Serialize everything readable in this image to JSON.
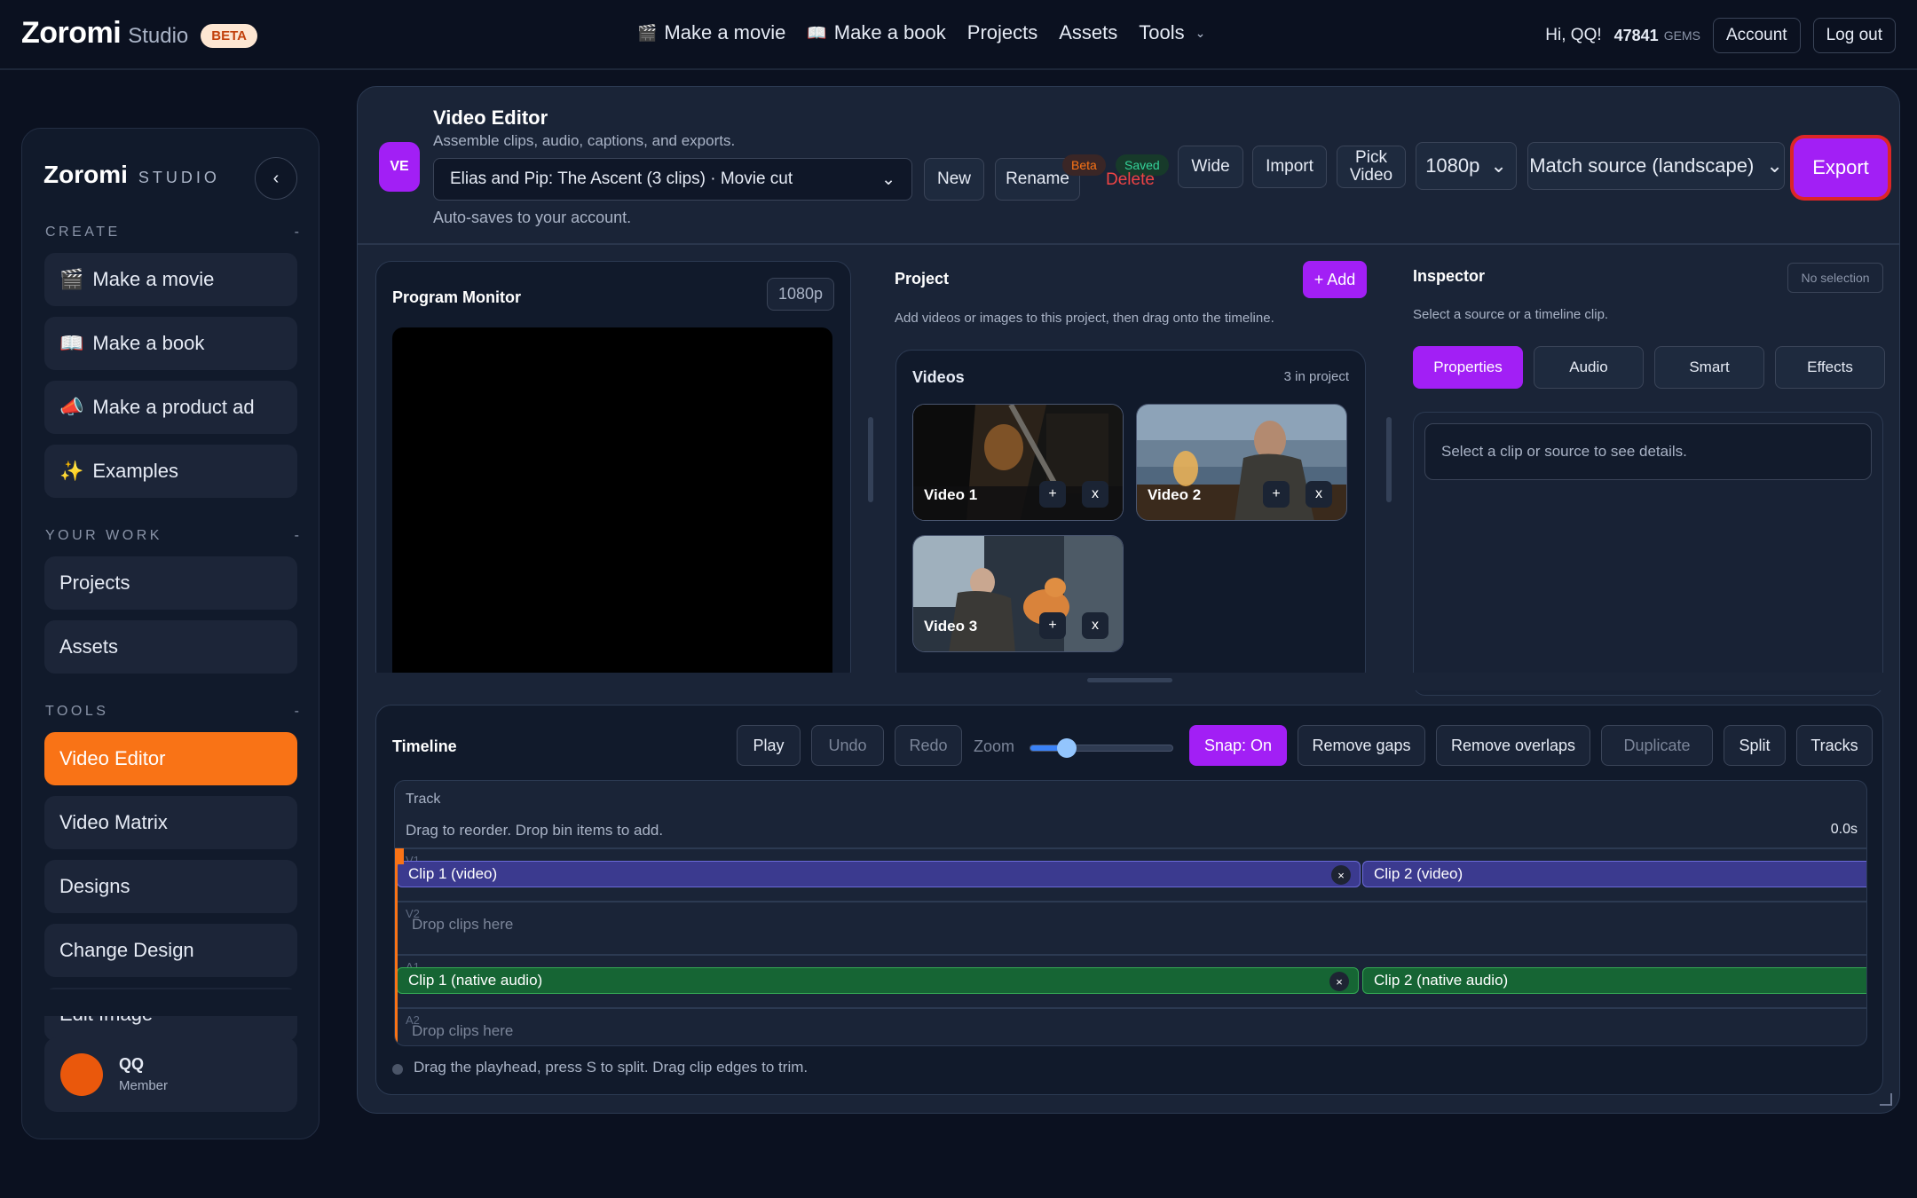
{
  "topnav": {
    "brand": "Zoromi",
    "brand_sub": "Studio",
    "beta": "BETA",
    "items": [
      {
        "icon": "🎬",
        "label": "Make a movie"
      },
      {
        "icon": "📖",
        "label": "Make a book"
      },
      {
        "icon": "",
        "label": "Projects"
      },
      {
        "icon": "",
        "label": "Assets"
      },
      {
        "icon": "",
        "label": "Tools"
      }
    ],
    "greeting": "Hi, QQ!",
    "gems": "47841",
    "gems_label": "GEMS",
    "account": "Account",
    "logout": "Log out"
  },
  "sidebar": {
    "brand": "Zoromi",
    "brand_sub": "STUDIO",
    "collapse": "‹",
    "sections": {
      "create": "CREATE",
      "work": "YOUR WORK",
      "tools": "TOOLS",
      "dash": "-"
    },
    "create_items": [
      {
        "icon": "🎬",
        "label": "Make a movie"
      },
      {
        "icon": "📖",
        "label": "Make a book"
      },
      {
        "icon": "📣",
        "label": "Make a product ad"
      },
      {
        "icon": "✨",
        "label": "Examples"
      }
    ],
    "work_items": [
      "Projects",
      "Assets"
    ],
    "tool_items": [
      "Video Editor",
      "Video Matrix",
      "Designs",
      "Change Design",
      "Edit Image"
    ],
    "user": {
      "name": "QQ",
      "role": "Member"
    }
  },
  "editor": {
    "badge": "VE",
    "title": "Video Editor",
    "subtitle": "Assemble clips, audio, captions, and exports.",
    "autosave": "Auto-saves to your account.",
    "project": "Elias and Pip: The Ascent (3 clips) · Movie cut",
    "new": "New",
    "rename": "Rename",
    "delete": "Delete",
    "beta_tag": "Beta",
    "saved_tag": "Saved",
    "wide": "Wide",
    "import": "Import",
    "pick_video_1": "Pick",
    "pick_video_2": "Video",
    "resolution": "1080p",
    "aspect": "Match source (landscape)",
    "export": "Export"
  },
  "monitor": {
    "title": "Program Monitor",
    "res": "1080p"
  },
  "project": {
    "title": "Project",
    "add": "+ Add",
    "hint": "Add videos or images to this project, then drag onto the timeline.",
    "bin_title": "Videos",
    "bin_count": "3 in project",
    "videos": [
      {
        "label": "Video 1",
        "add": "+",
        "remove": "x"
      },
      {
        "label": "Video 2",
        "add": "+",
        "remove": "x"
      },
      {
        "label": "Video 3",
        "add": "+",
        "remove": "x"
      }
    ]
  },
  "inspector": {
    "title": "Inspector",
    "no_selection": "No selection",
    "hint": "Select a source or a timeline clip.",
    "tabs": [
      "Properties",
      "Audio",
      "Smart",
      "Effects"
    ],
    "active_tab": "Properties",
    "details": "Select a clip or source to see details."
  },
  "timeline": {
    "title": "Timeline",
    "play": "Play",
    "undo": "Undo",
    "redo": "Redo",
    "zoom": "Zoom",
    "zoom_level": 0.25,
    "snap": "Snap: On",
    "remove_gaps": "Remove gaps",
    "remove_overlaps": "Remove overlaps",
    "duplicate": "Duplicate",
    "split": "Split",
    "tracks_btn": "Tracks",
    "track_head": "Track",
    "track_sub": "Drag to reorder. Drop bin items to add.",
    "time": "0.0s",
    "lanes": {
      "v1": "V1",
      "v2": "V2",
      "a1": "A1",
      "a2": "A2"
    },
    "drop": "Drop clips here",
    "clips": {
      "v1a": "Clip 1 (video)",
      "v1b": "Clip 2 (video)",
      "a1a": "Clip 1 (native audio)",
      "a1b": "Clip 2 (native audio)",
      "close": "×"
    },
    "hint": "Drag the playhead, press S to split. Drag clip edges to trim."
  }
}
